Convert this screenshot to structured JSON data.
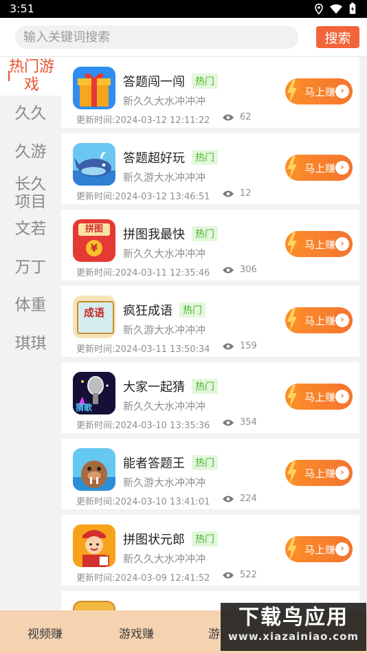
{
  "status_bar": {
    "time": "3:51"
  },
  "search": {
    "placeholder": "输入关键词搜索",
    "button_label": "搜索"
  },
  "sidebar": {
    "active": "热门游戏",
    "items": [
      "久久",
      "久游",
      "长久\n项目",
      "文若",
      "万丁",
      "体重",
      "琪琪"
    ]
  },
  "cards": [
    {
      "title": "答题闯一闯",
      "badge": "热门",
      "subtitle": "新久久大水冲冲冲",
      "time": "更新时间:2024-03-12 12:11:22",
      "views": "62",
      "button": "马上赚",
      "icon": "gift-box-icon"
    },
    {
      "title": "答题超好玩",
      "badge": "热门",
      "subtitle": "新久游大水冲冲冲",
      "time": "更新时间:2024-03-12 13:46:51",
      "views": "12",
      "button": "马上赚",
      "icon": "whale-icon"
    },
    {
      "title": "拼图我最快",
      "badge": "热门",
      "subtitle": "新久久大水冲冲冲",
      "time": "更新时间:2024-03-11 12:35:46",
      "views": "306",
      "button": "马上赚",
      "icon": "puzzle-envelope-icon",
      "icon_text": "拼图"
    },
    {
      "title": "疯狂成语",
      "badge": "热门",
      "subtitle": "新久游大水冲冲冲",
      "time": "更新时间:2024-03-11 13:50:34",
      "views": "159",
      "button": "马上赚",
      "icon": "idiom-scroll-icon",
      "icon_text": "成语"
    },
    {
      "title": "大家一起猜",
      "badge": "热门",
      "subtitle": "新久久大水冲冲冲",
      "time": "更新时间:2024-03-10 13:35:36",
      "views": "354",
      "button": "马上赚",
      "icon": "microphone-icon",
      "icon_text": "猜歌"
    },
    {
      "title": "能者答题王",
      "badge": "热门",
      "subtitle": "新久游大水冲冲冲",
      "time": "更新时间:2024-03-10 13:41:01",
      "views": "224",
      "button": "马上赚",
      "icon": "walrus-icon"
    },
    {
      "title": "拼图状元郎",
      "badge": "热门",
      "subtitle": "新久久大水冲冲冲",
      "time": "更新时间:2024-03-09 12:41:52",
      "views": "522",
      "button": "马上赚",
      "icon": "scholar-boy-icon"
    }
  ],
  "bottom_nav": [
    "视频赚",
    "游戏赚",
    "游"
  ],
  "watermark": {
    "main": "下载鸟应用",
    "url": "www.xiazainiao.com"
  },
  "colors": {
    "accent": "#f2643a",
    "badge_text": "#47b52a",
    "button": "#f5742e",
    "nav_bg": "#f5d3b1"
  }
}
